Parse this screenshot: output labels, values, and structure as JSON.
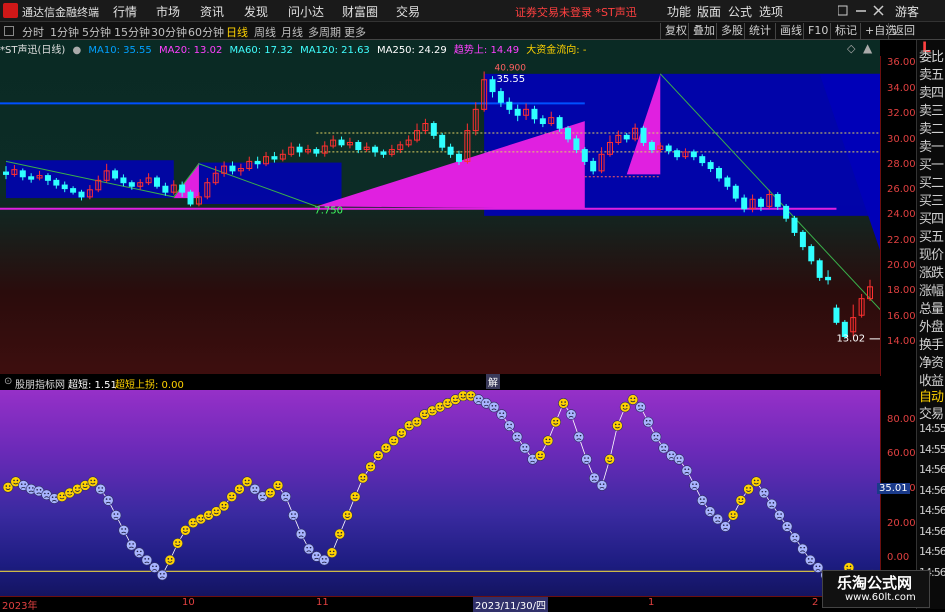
{
  "titlebar": {
    "app_name": "通达信金融终端",
    "menus": [
      "行情",
      "市场",
      "资讯",
      "发现",
      "问小达",
      "财富圈",
      "交易"
    ],
    "warning": "证券交易未登录  *ST声迅",
    "right_menus": [
      "功能",
      "版面",
      "公式",
      "选项"
    ],
    "guest": "游客"
  },
  "toolbar": {
    "periods": [
      "分时",
      "1分钟",
      "5分钟",
      "15分钟",
      "30分钟",
      "60分钟",
      "日线",
      "周线",
      "月线",
      "多周期",
      "更多"
    ],
    "active_period": "日线",
    "right_buttons": [
      "复权",
      "叠加",
      "多股",
      "统计",
      "画线",
      "F10",
      "标记",
      "+自选",
      "返回"
    ]
  },
  "main": {
    "stock_title": "*ST声迅(日线)",
    "ma": [
      {
        "label": "MA10: 35.55",
        "color": "#00a0ff"
      },
      {
        "label": "MA20: 13.02",
        "color": "#ff40ff"
      },
      {
        "label": "MA60: 17.32",
        "color": "#40ffff"
      },
      {
        "label": "MA120: 21.63",
        "color": "#40ffff"
      },
      {
        "label": "MA250: 24.29",
        "color": "#ffffff"
      }
    ],
    "trend_label": "趋势上: 14.49",
    "fund_label": "大资金流向: -",
    "annotations": {
      "high": "35.55",
      "high_top": "40.900",
      "low": "7.750",
      "last": "13.02",
      "stamp": "解"
    },
    "y_ticks": [
      "36.00",
      "34.00",
      "32.00",
      "30.00",
      "28.00",
      "26.00",
      "24.00",
      "22.00",
      "20.00",
      "18.00",
      "16.00",
      "14.00"
    ]
  },
  "sub": {
    "indicator_name": "股朋指标网",
    "v1": "超短: 1.51",
    "v2": "超短上拐: 0.00",
    "y_ticks": [
      "80.00",
      "60.00",
      "40.00",
      "20.00",
      "0.00"
    ],
    "current": "35.01"
  },
  "xaxis": {
    "labels": [
      "2023年",
      "10",
      "11",
      "2023/11/30/四",
      "1",
      "2"
    ]
  },
  "side": {
    "items": [
      "委比",
      "卖五",
      "卖四",
      "卖三",
      "卖二",
      "卖一",
      "买一",
      "买二",
      "买三",
      "买四",
      "买五",
      "现价",
      "涨跌",
      "涨幅",
      "总量",
      "外盘",
      "换手",
      "净资",
      "收益"
    ],
    "tabs": [
      "自动",
      "交易"
    ],
    "times": [
      "14:55",
      "14:55",
      "14:56",
      "14:56",
      "14:56",
      "14:56",
      "14:56",
      "14:56"
    ]
  },
  "watermark": {
    "name": "乐淘公式网",
    "url": "www.60lt.com"
  },
  "colors": {
    "up": "#ff3030",
    "down": "#30ffff",
    "magenta": "#e020e0",
    "blue": "#0000b8",
    "yellow": "#ffd200"
  },
  "chart_data": {
    "type": "candlestick",
    "title": "*ST声迅(日线)",
    "ylim": [
      13,
      37
    ],
    "candles": [
      [
        27.7,
        27.5,
        28.2,
        27.1
      ],
      [
        27.5,
        27.9,
        28.3,
        27.3
      ],
      [
        27.8,
        27.3,
        28.0,
        27.0
      ],
      [
        27.3,
        27.1,
        27.6,
        26.8
      ],
      [
        27.2,
        27.4,
        27.8,
        27.0
      ],
      [
        27.4,
        27.0,
        27.6,
        26.6
      ],
      [
        27.0,
        26.6,
        27.2,
        26.3
      ],
      [
        26.6,
        26.3,
        26.9,
        26.0
      ],
      [
        26.3,
        26.0,
        26.5,
        25.8
      ],
      [
        26.0,
        25.6,
        26.2,
        25.3
      ],
      [
        25.6,
        26.2,
        26.6,
        25.4
      ],
      [
        26.2,
        27.0,
        27.4,
        26.0
      ],
      [
        27.0,
        27.8,
        28.4,
        26.8
      ],
      [
        27.8,
        27.2,
        28.0,
        27.0
      ],
      [
        27.2,
        26.8,
        27.5,
        26.5
      ],
      [
        26.8,
        26.5,
        27.0,
        26.2
      ],
      [
        26.5,
        26.8,
        27.1,
        26.2
      ],
      [
        26.8,
        27.2,
        27.6,
        26.6
      ],
      [
        27.2,
        26.5,
        27.4,
        26.3
      ],
      [
        26.5,
        26.0,
        26.8,
        25.7
      ],
      [
        26.0,
        26.6,
        27.0,
        25.8
      ],
      [
        26.6,
        26.0,
        26.9,
        25.6
      ],
      [
        26.0,
        25.0,
        26.2,
        24.8
      ],
      [
        25.0,
        25.6,
        26.0,
        24.8
      ],
      [
        25.6,
        26.8,
        27.2,
        25.4
      ],
      [
        26.8,
        27.6,
        28.2,
        26.6
      ],
      [
        27.6,
        28.2,
        28.6,
        27.3
      ],
      [
        28.2,
        27.8,
        28.6,
        27.5
      ],
      [
        27.8,
        28.0,
        28.4,
        27.4
      ],
      [
        28.0,
        28.6,
        29.0,
        27.8
      ],
      [
        28.6,
        28.4,
        29.0,
        28.0
      ],
      [
        28.4,
        29.0,
        29.4,
        28.2
      ],
      [
        29.0,
        28.8,
        29.4,
        28.5
      ],
      [
        28.8,
        29.2,
        29.6,
        28.6
      ],
      [
        29.2,
        29.8,
        30.2,
        29.0
      ],
      [
        29.8,
        29.4,
        30.1,
        29.0
      ],
      [
        29.4,
        29.6,
        30.0,
        29.2
      ],
      [
        29.6,
        29.3,
        29.8,
        29.0
      ],
      [
        29.3,
        29.9,
        30.3,
        29.0
      ],
      [
        29.9,
        30.4,
        30.8,
        29.7
      ],
      [
        30.4,
        30.0,
        30.7,
        29.8
      ],
      [
        30.0,
        30.2,
        30.6,
        29.7
      ],
      [
        30.2,
        29.6,
        30.4,
        29.3
      ],
      [
        29.6,
        29.8,
        30.2,
        29.4
      ],
      [
        29.8,
        29.4,
        30.0,
        29.0
      ],
      [
        29.4,
        29.2,
        29.6,
        28.9
      ],
      [
        29.2,
        29.6,
        30.0,
        29.0
      ],
      [
        29.6,
        30.0,
        30.3,
        29.3
      ],
      [
        30.0,
        30.4,
        30.8,
        29.8
      ],
      [
        30.4,
        31.2,
        31.8,
        30.2
      ],
      [
        31.2,
        31.8,
        32.2,
        30.9
      ],
      [
        31.8,
        30.8,
        32.0,
        30.5
      ],
      [
        30.8,
        29.8,
        31.0,
        29.5
      ],
      [
        29.8,
        29.2,
        30.1,
        28.9
      ],
      [
        29.2,
        28.6,
        29.5,
        28.3
      ],
      [
        28.6,
        31.2,
        31.8,
        28.4
      ],
      [
        31.2,
        33.0,
        33.6,
        30.8
      ],
      [
        33.0,
        35.5,
        36.2,
        32.8
      ],
      [
        35.5,
        34.5,
        35.8,
        34.0
      ],
      [
        34.5,
        33.6,
        34.8,
        33.2
      ],
      [
        33.6,
        33.0,
        34.0,
        32.6
      ],
      [
        33.0,
        32.5,
        33.4,
        32.0
      ],
      [
        32.5,
        33.0,
        33.5,
        32.1
      ],
      [
        33.0,
        32.2,
        33.3,
        31.8
      ],
      [
        32.2,
        31.8,
        32.5,
        31.5
      ],
      [
        31.8,
        32.3,
        32.8,
        31.6
      ],
      [
        32.3,
        31.4,
        32.5,
        31.1
      ],
      [
        31.4,
        30.5,
        31.6,
        30.2
      ],
      [
        30.5,
        29.6,
        30.8,
        29.3
      ],
      [
        29.6,
        28.6,
        29.8,
        28.3
      ],
      [
        28.6,
        27.8,
        28.9,
        27.5
      ],
      [
        27.8,
        29.2,
        29.8,
        27.6
      ],
      [
        29.2,
        30.2,
        30.8,
        29.0
      ],
      [
        30.2,
        30.8,
        31.2,
        30.0
      ],
      [
        30.8,
        30.5,
        31.0,
        30.2
      ],
      [
        30.5,
        31.4,
        31.8,
        30.3
      ],
      [
        31.4,
        30.2,
        31.6,
        29.9
      ],
      [
        30.2,
        29.6,
        30.4,
        29.3
      ],
      [
        29.6,
        29.9,
        30.2,
        29.4
      ],
      [
        29.9,
        29.5,
        30.1,
        29.2
      ],
      [
        29.5,
        29.0,
        29.7,
        28.7
      ],
      [
        29.0,
        29.4,
        29.7,
        28.8
      ],
      [
        29.4,
        29.0,
        29.6,
        28.7
      ],
      [
        29.0,
        28.5,
        29.2,
        28.2
      ],
      [
        28.5,
        28.0,
        28.7,
        27.7
      ],
      [
        28.0,
        27.2,
        28.2,
        26.9
      ],
      [
        27.2,
        26.5,
        27.4,
        26.2
      ],
      [
        26.5,
        25.5,
        26.7,
        25.2
      ],
      [
        25.5,
        24.6,
        25.8,
        24.3
      ],
      [
        24.6,
        25.4,
        25.8,
        24.3
      ],
      [
        25.4,
        24.8,
        25.6,
        24.4
      ],
      [
        24.8,
        25.8,
        26.2,
        24.6
      ],
      [
        25.8,
        24.8,
        26.0,
        24.5
      ],
      [
        24.8,
        23.8,
        25.0,
        23.5
      ],
      [
        23.8,
        22.6,
        24.0,
        22.3
      ],
      [
        22.6,
        21.4,
        22.8,
        21.1
      ],
      [
        21.4,
        20.2,
        21.6,
        19.9
      ],
      [
        20.2,
        18.8,
        20.4,
        18.5
      ],
      [
        18.8,
        18.6,
        19.4,
        18.2
      ],
      [
        16.2,
        15.0,
        16.5,
        14.8
      ],
      [
        15.0,
        13.8,
        15.2,
        13.6
      ],
      [
        14.2,
        15.4,
        16.5,
        13.8
      ],
      [
        15.6,
        17.0,
        17.4,
        15.4
      ],
      [
        17.0,
        18.0,
        18.6,
        16.8
      ]
    ],
    "oscillator": {
      "name": "超短",
      "ylim": [
        -10,
        95
      ],
      "values": [
        45,
        48,
        46,
        44,
        43,
        41,
        39,
        40,
        42,
        44,
        46,
        48,
        44,
        38,
        30,
        22,
        14,
        10,
        6,
        2,
        -2,
        6,
        15,
        22,
        26,
        28,
        30,
        32,
        35,
        40,
        44,
        48,
        44,
        40,
        42,
        46,
        40,
        30,
        20,
        12,
        8,
        6,
        10,
        20,
        30,
        40,
        50,
        56,
        62,
        66,
        70,
        74,
        78,
        80,
        84,
        86,
        88,
        90,
        92,
        94,
        94,
        92,
        90,
        88,
        84,
        78,
        72,
        66,
        60,
        62,
        70,
        80,
        90,
        84,
        72,
        60,
        50,
        46,
        60,
        78,
        88,
        92,
        88,
        80,
        72,
        66,
        62,
        60,
        54,
        46,
        38,
        32,
        28,
        24,
        30,
        38,
        44,
        48,
        42,
        36,
        30,
        24,
        18,
        12,
        6,
        2,
        -2,
        -6,
        -4,
        2,
        -4,
        -6,
        -2
      ],
      "rising_color": "#ffd200",
      "falling_color": "#a8b4ff",
      "zero_line": 0
    }
  }
}
